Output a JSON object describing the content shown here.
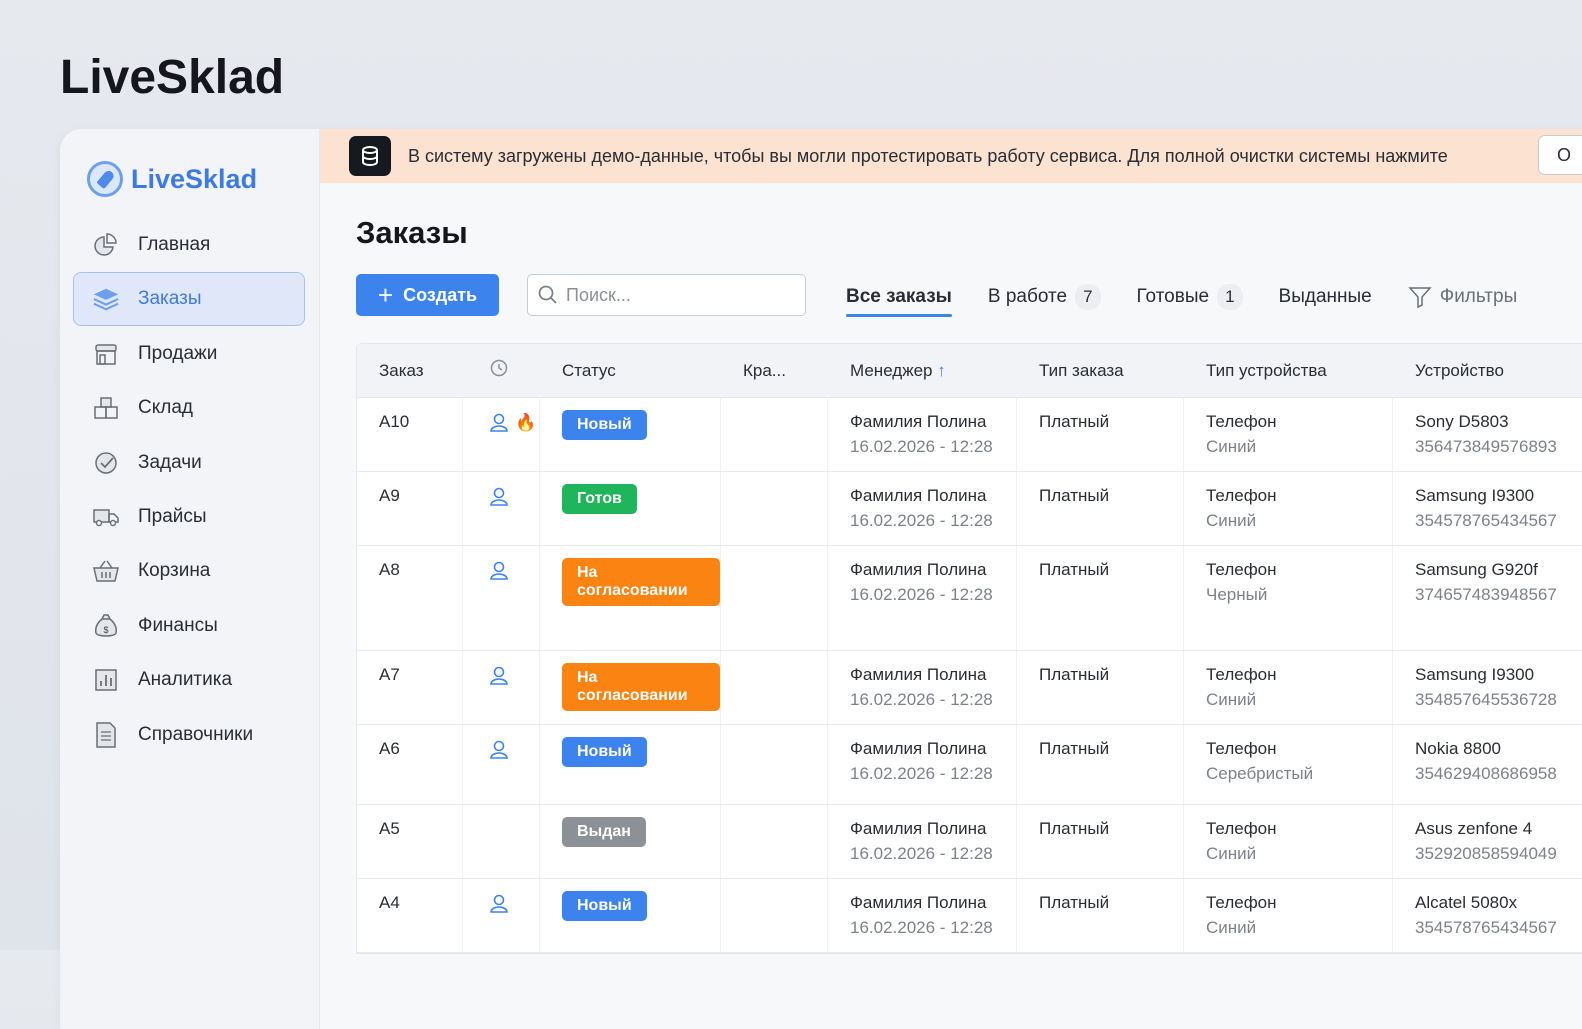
{
  "page_heading": "LiveSklad",
  "sidebar": {
    "logo": "LiveSklad",
    "items": [
      {
        "label": "Главная",
        "icon": "pie-chart-icon"
      },
      {
        "label": "Заказы",
        "icon": "layers-icon",
        "active": true
      },
      {
        "label": "Продажи",
        "icon": "store-icon"
      },
      {
        "label": "Склад",
        "icon": "boxes-icon"
      },
      {
        "label": "Задачи",
        "icon": "check-circle-icon"
      },
      {
        "label": "Прайсы",
        "icon": "truck-icon"
      },
      {
        "label": "Корзина",
        "icon": "basket-icon"
      },
      {
        "label": "Финансы",
        "icon": "money-bag-icon"
      },
      {
        "label": "Аналитика",
        "icon": "bar-chart-icon"
      },
      {
        "label": "Справочники",
        "icon": "document-icon"
      }
    ]
  },
  "banner": {
    "text": "В систему загружены демо-данные, чтобы вы могли протестировать работу сервиса. Для полной очистки системы нажмите",
    "button": "О"
  },
  "main": {
    "title": "Заказы",
    "create_label": "Создать",
    "search_placeholder": "Поиск...",
    "tabs": [
      {
        "label": "Все заказы",
        "active": true
      },
      {
        "label": "В работе",
        "count": "7"
      },
      {
        "label": "Готовые",
        "count": "1"
      },
      {
        "label": "Выданные"
      }
    ],
    "filters_label": "Фильтры"
  },
  "colors": {
    "accent": "#3d83ee",
    "new": "#3d83ee",
    "ready": "#1fb55a",
    "approval": "#fb8312",
    "issued": "#8c9197"
  },
  "table": {
    "headers": [
      "Заказ",
      "",
      "Статус",
      "Кра...",
      "Менеджер",
      "Тип заказа",
      "Тип устройства",
      "Устройство"
    ],
    "rows": [
      {
        "id": "A10",
        "user": true,
        "fire": true,
        "status": "Новый",
        "status_color": "#3d83ee",
        "manager": "Фамилия Полина",
        "date": "16.02.2026 - 12:28",
        "order_type": "Платный",
        "device_type": "Телефон",
        "color": "Синий",
        "device": "Sony D5803",
        "imei": "356473849576893"
      },
      {
        "id": "A9",
        "user": true,
        "status": "Готов",
        "status_color": "#1fb55a",
        "manager": "Фамилия Полина",
        "date": "16.02.2026 - 12:28",
        "order_type": "Платный",
        "device_type": "Телефон",
        "color": "Синий",
        "device": "Samsung I9300",
        "imei": "354578765434567"
      },
      {
        "id": "A8",
        "user": true,
        "status": "На согласовании",
        "status_color": "#fb8312",
        "manager": "Фамилия Полина",
        "date": "16.02.2026 - 12:28",
        "order_type": "Платный",
        "device_type": "Телефон",
        "color": "Черный",
        "device": "Samsung G920f",
        "imei": "374657483948567"
      },
      {
        "id": "A7",
        "user": true,
        "status": "На согласовании",
        "status_color": "#fb8312",
        "manager": "Фамилия Полина",
        "date": "16.02.2026 - 12:28",
        "order_type": "Платный",
        "device_type": "Телефон",
        "color": "Синий",
        "device": "Samsung I9300",
        "imei": "354857645536728"
      },
      {
        "id": "A6",
        "user": true,
        "status": "Новый",
        "status_color": "#3d83ee",
        "manager": "Фамилия Полина",
        "date": "16.02.2026 - 12:28",
        "order_type": "Платный",
        "device_type": "Телефон",
        "color": "Серебристый",
        "device": "Nokia 8800",
        "imei": "354629408686958"
      },
      {
        "id": "A5",
        "user": false,
        "status": "Выдан",
        "status_color": "#8c9197",
        "manager": "Фамилия Полина",
        "date": "16.02.2026 - 12:28",
        "order_type": "Платный",
        "device_type": "Телефон",
        "color": "Синий",
        "device": "Asus zenfone 4",
        "imei": "352920858594049"
      },
      {
        "id": "A4",
        "user": true,
        "status": "Новый",
        "status_color": "#3d83ee",
        "manager": "Фамилия Полина",
        "date": "16.02.2026 - 12:28",
        "order_type": "Платный",
        "device_type": "Телефон",
        "color": "Синий",
        "device": "Alcatel 5080x",
        "imei": "354578765434567"
      }
    ]
  }
}
